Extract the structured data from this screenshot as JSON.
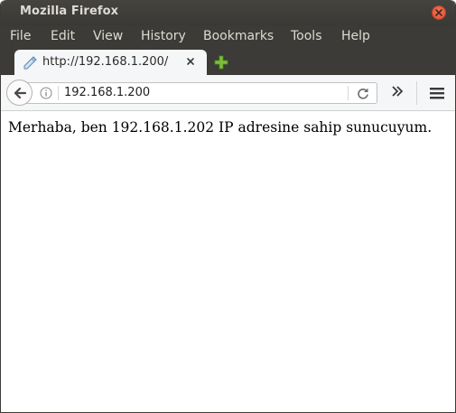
{
  "window": {
    "title": "Mozilla Firefox"
  },
  "menu": {
    "items": [
      {
        "label": "File"
      },
      {
        "label": "Edit"
      },
      {
        "label": "View"
      },
      {
        "label": "History"
      },
      {
        "label": "Bookmarks"
      },
      {
        "label": "Tools"
      },
      {
        "label": "Help"
      }
    ]
  },
  "tabs": [
    {
      "title": "http://192.168.1.200/",
      "active": true
    }
  ],
  "navbar": {
    "url": "192.168.1.200"
  },
  "content": {
    "text": "Merhaba, ben 192.168.1.202 IP adresine sahip sunucuyum."
  },
  "icons": {
    "window_close": "close-icon",
    "tab_favicon": "page-icon",
    "tab_close": "close-icon",
    "new_tab": "plus-icon",
    "back": "back-arrow-icon",
    "site_info": "info-icon",
    "reload": "reload-icon",
    "overflow": "double-chevron-icon",
    "app_menu": "hamburger-icon"
  },
  "colors": {
    "titlebar": "#3c3b37",
    "close_button": "#e9573a",
    "new_tab_plus": "#7bbf3a",
    "toolbar": "#f5f6f7"
  }
}
